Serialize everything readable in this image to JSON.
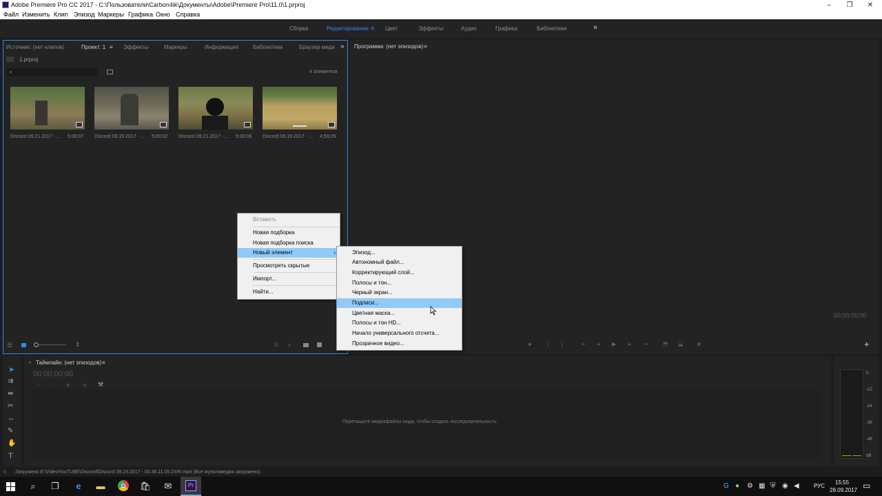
{
  "window": {
    "title": "Adobe Premiere Pro CC 2017 - C:\\Пользователи\\Carbon4ik\\Документы\\Adobe\\Premiere Pro\\11.0\\1.prproj",
    "minimize": "–",
    "maximize": "❐",
    "close": "✕"
  },
  "menubar": [
    "Файл",
    "Изменить",
    "Клип",
    "Эпизод",
    "Маркеры",
    "Графика",
    "Окно",
    "Справка"
  ],
  "workspaces": [
    "Сборка",
    "Редактирование",
    "Цвет",
    "Эффекты",
    "Аудио",
    "Графика",
    "Библиотеки"
  ],
  "workspace_active": "Редактирование",
  "workspace_menu_icon": "≡",
  "more_icon": "»",
  "project_panel": {
    "tabs": [
      "Источник: (нет клипов)",
      "Проект: 1",
      "Эффекты",
      "Маркеры",
      "Информация",
      "Библиотеки",
      "Браузер меди"
    ],
    "tab_menu_icon": "≡",
    "project_file": "1.prproj",
    "item_count": "4 элементов",
    "clips": [
      {
        "name": "Discord 09.21.2017 - ...",
        "duration": "5;00;07"
      },
      {
        "name": "Discord 09.19.2017 - ...",
        "duration": "5;00;02"
      },
      {
        "name": "Discord 09.21.2017 - ...",
        "duration": "5;00;06"
      },
      {
        "name": "Discord 09.19.2017 - ...",
        "duration": "4;59;29"
      }
    ]
  },
  "program_panel": {
    "tab": "Программа: (нет эпизодов)",
    "tab_menu_icon": "≡",
    "timecode": "00;00;00;00",
    "add_icon": "+"
  },
  "timeline_panel": {
    "tab": "Таймлайн: (нет эпизодов)",
    "tab_menu_icon": "≡",
    "timecode": "00;00;00;00",
    "drop_hint": "Перетащите медиафайлы сюда, чтобы создать последовательность."
  },
  "audio_meter": {
    "labels": [
      "0",
      "-12",
      "-24",
      "-36",
      "-48",
      "dB"
    ]
  },
  "context_menu": {
    "items": [
      {
        "label": "Вставить",
        "disabled": true
      },
      {
        "label": "Новая подборка"
      },
      {
        "label": "Новая подборка поиска"
      },
      {
        "label": "Новый элемент",
        "highlighted": true,
        "submenu_arrow": "›"
      },
      {
        "label": "Просмотреть скрытые"
      },
      {
        "label": "Импорт..."
      },
      {
        "label": "Найти..."
      }
    ]
  },
  "submenu": {
    "items": [
      {
        "label": "Эпизод..."
      },
      {
        "label": "Автономный файл..."
      },
      {
        "label": "Корректирующий слой..."
      },
      {
        "label": "Полосы и тон..."
      },
      {
        "label": "Черный экран..."
      },
      {
        "label": "Подписи...",
        "highlighted": true
      },
      {
        "label": "Цветная маска..."
      },
      {
        "label": "Полосы и тон HD..."
      },
      {
        "label": "Начало универсального отсчета..."
      },
      {
        "label": "Прозрачное видео..."
      }
    ]
  },
  "status_bar": {
    "text": "Загружено E:\\VideoYouTUBE\\Discord\\Discord 09.19.2017 - 00.48.11.05.DVR.mp4 (Все мультимедиа загружено)."
  },
  "taskbar": {
    "language": "РУС",
    "time": "15:55",
    "date": "28.09.2017"
  },
  "colors": {
    "accent": "#2d8ceb",
    "panel": "#232323",
    "menu_highlight": "#91c9f7",
    "premiere_icon": "#2a1747"
  }
}
